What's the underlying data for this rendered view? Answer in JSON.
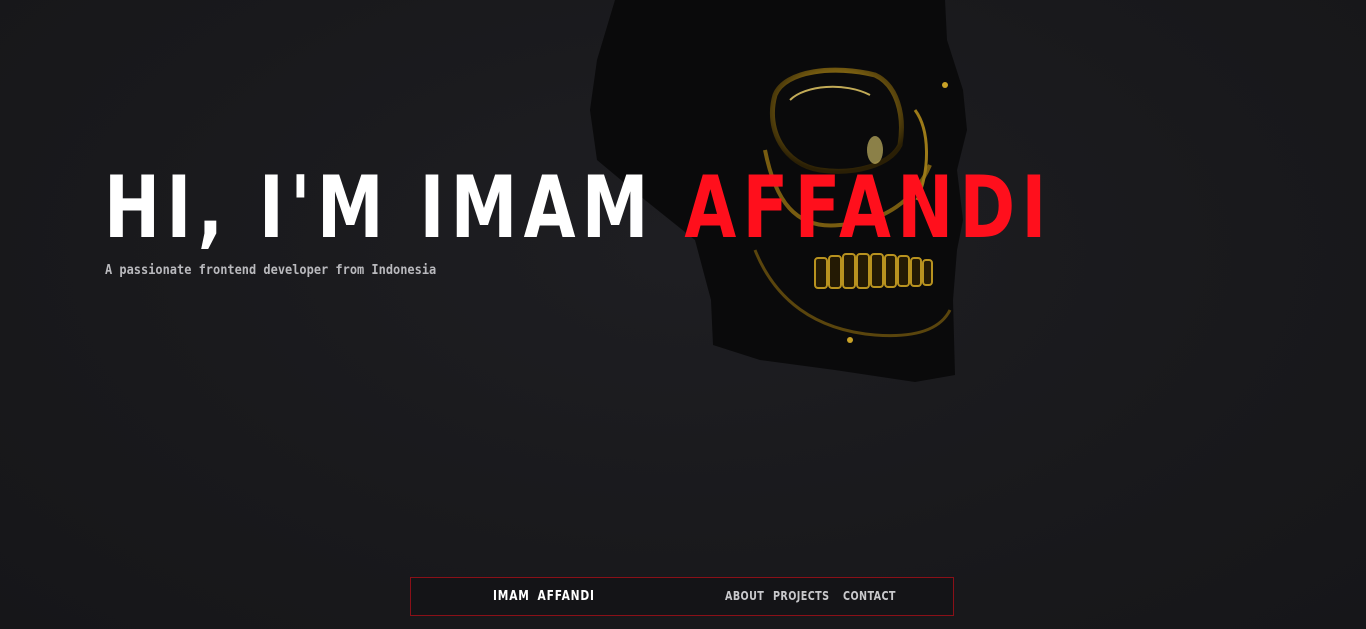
{
  "hero": {
    "title_main": "HI, I'M IMAM ",
    "title_accent": "AFFANDI",
    "subtitle": "A passionate frontend developer from Indonesia"
  },
  "illustration": {
    "icon": "skull-icon"
  },
  "nav": {
    "brand": "IMAM AFFANDI",
    "links": [
      {
        "label": "ABOUT"
      },
      {
        "label": "PROJECTS"
      },
      {
        "label": "CONTACT"
      }
    ]
  },
  "colors": {
    "accent": "#ff0f1c",
    "background": "#1a1a1d",
    "nav_border": "#8a1018",
    "skull_gold": "#c9a227"
  }
}
